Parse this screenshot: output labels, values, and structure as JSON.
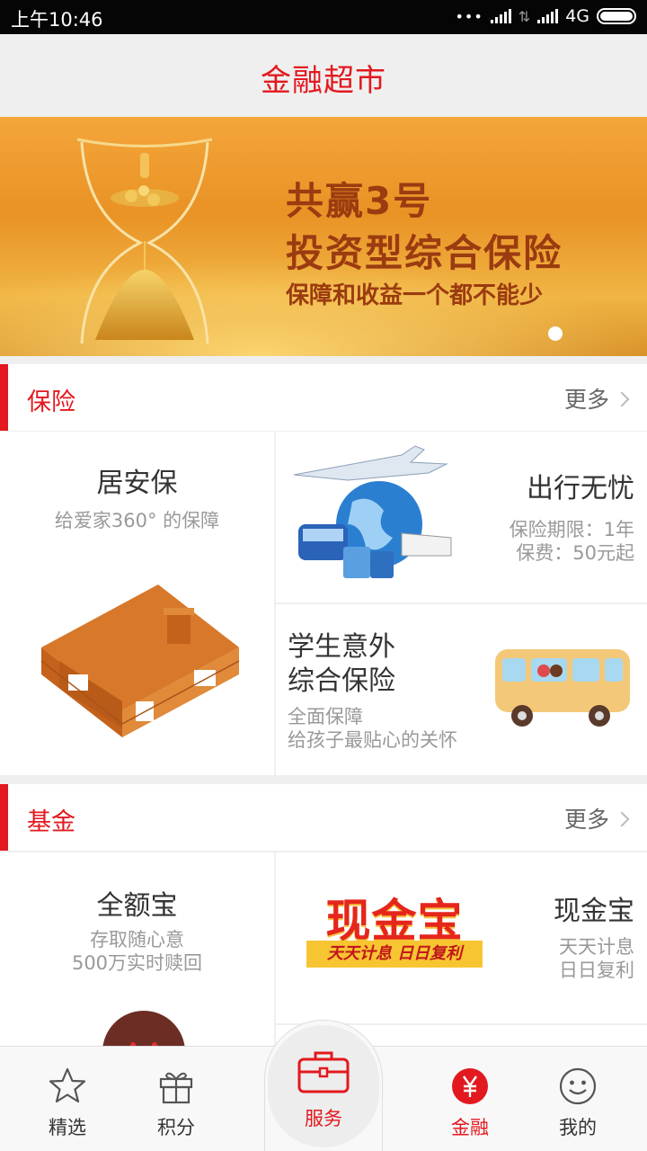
{
  "status_bar": {
    "time": "上午10:46",
    "network": "4G"
  },
  "header": {
    "title": "金融超市"
  },
  "banner": {
    "line1": "共赢3号",
    "line2": "投资型综合保险",
    "line3": "保障和收益一个都不能少"
  },
  "sections": [
    {
      "title": "保险",
      "more": "更多",
      "cards": [
        {
          "title": "居安保",
          "subtitle": "给爱家360° 的保障"
        },
        {
          "title": "出行无忧",
          "line1": "保险期限：1年",
          "line2": "保费：50元起"
        },
        {
          "title_line1": "学生意外",
          "title_line2": "综合保险",
          "line1": "全面保障",
          "line2": "给孩子最贴心的关怀"
        }
      ]
    },
    {
      "title": "基金",
      "more": "更多",
      "cards": [
        {
          "title": "全额宝",
          "line1": "存取随心意",
          "line2": "500万实时赎回"
        },
        {
          "title": "现金宝",
          "line1": "天天计息",
          "line2": "日日复利",
          "logo_text": "现金宝",
          "logo_tagline": "天天计息 日日复利"
        }
      ]
    }
  ],
  "bottom_nav": [
    {
      "label": "精选",
      "icon": "star-icon",
      "active": false
    },
    {
      "label": "积分",
      "icon": "gift-icon",
      "active": false
    },
    {
      "label": "服务",
      "icon": "briefcase-icon",
      "active": false
    },
    {
      "label": "金融",
      "icon": "yuan-icon",
      "active": true
    },
    {
      "label": "我的",
      "icon": "smiley-icon",
      "active": false
    }
  ],
  "colors": {
    "accent": "#e2191f",
    "banner": "#ef9d2c",
    "divider": "#e5e5e5"
  }
}
